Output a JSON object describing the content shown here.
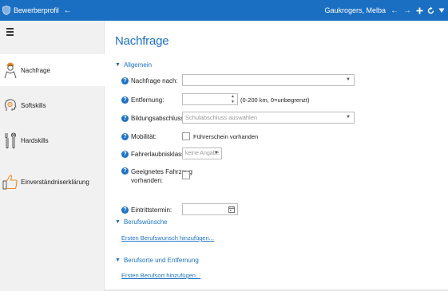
{
  "titlebar": {
    "app_title": "Bewerberprofil",
    "back_icon": "arrow-left-icon",
    "user_name": "Gaukrogers, Melba",
    "nav_back": "←",
    "nav_forward": "→"
  },
  "sidebar": {
    "items": [
      {
        "label": "Nachfrage",
        "icon": "person-hardhat-icon",
        "active": true
      },
      {
        "label": "Softskills",
        "icon": "head-gear-icon",
        "active": false
      },
      {
        "label": "Hardskills",
        "icon": "tools-icon",
        "active": false
      },
      {
        "label": "Einverständniserklärung",
        "icon": "thumbs-up-icon",
        "active": false
      }
    ]
  },
  "main": {
    "title": "Nachfrage",
    "sections": {
      "allgemein": {
        "title": "Allgemein",
        "fields": {
          "nachfrage_nach": {
            "label": "Nachfrage nach:",
            "value": ""
          },
          "entfernung": {
            "label": "Entfernung:",
            "value": "",
            "hint": "(0-200 km, 0=unbegrenzt)"
          },
          "bildungsabschluss": {
            "label": "Bildungsabschluss:",
            "placeholder": "Schulabschluss auswählen"
          },
          "mobilitaet": {
            "label": "Mobilität:",
            "checkbox_label": "Führerschein vorhanden"
          },
          "fahrerlaubnisklasse": {
            "label": "Fahrerlaubnisklasse(n):",
            "value": "keine Angabe"
          },
          "fahrzeug": {
            "label_line1": "Geeignetes Fahrzeug",
            "label_line2": "vorhanden:"
          },
          "eintrittstermin": {
            "label": "Eintrittstermin:",
            "value": ""
          }
        }
      },
      "berufswuensche": {
        "title": "Berufswünsche",
        "link": "Ersten Berufswunsch hinzufügen..."
      },
      "berufsorte": {
        "title": "Berufsorte und Entfernung",
        "link": "Ersten Berufsort hinzufügen..."
      }
    }
  },
  "colors": {
    "titlebar": "#1b6fc2",
    "accent": "#1e72c4",
    "sidebar_bg": "#f1f1f1"
  }
}
